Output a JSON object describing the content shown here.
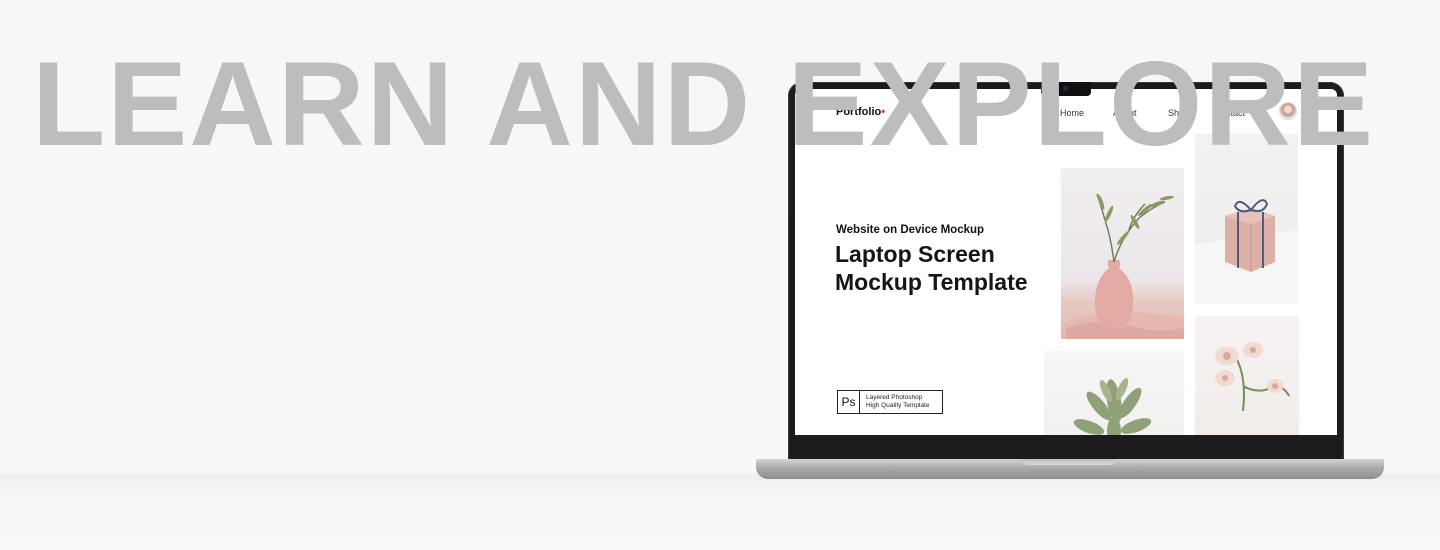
{
  "banner": {
    "headline": "LEARN AND EXPLORE"
  },
  "site": {
    "logo_text": "Portfolio",
    "nav": [
      "Home",
      "About",
      "Shop",
      "Contact"
    ],
    "hero_subtitle": "Website on Device Mockup",
    "hero_title_line1": "Laptop Screen",
    "hero_title_line2": "Mockup Template",
    "badge_logo": "Ps",
    "badge_line1": "Layered Photoshop",
    "badge_line2": "High Quality Template"
  },
  "colors": {
    "headline": "#bdbdbd",
    "background": "#f7f7f7",
    "laptop_bezel": "#1c1c1e",
    "logo_accent": "#dd3333"
  },
  "icons": {
    "avatar": "user-avatar",
    "camera": "webcam-notch"
  }
}
